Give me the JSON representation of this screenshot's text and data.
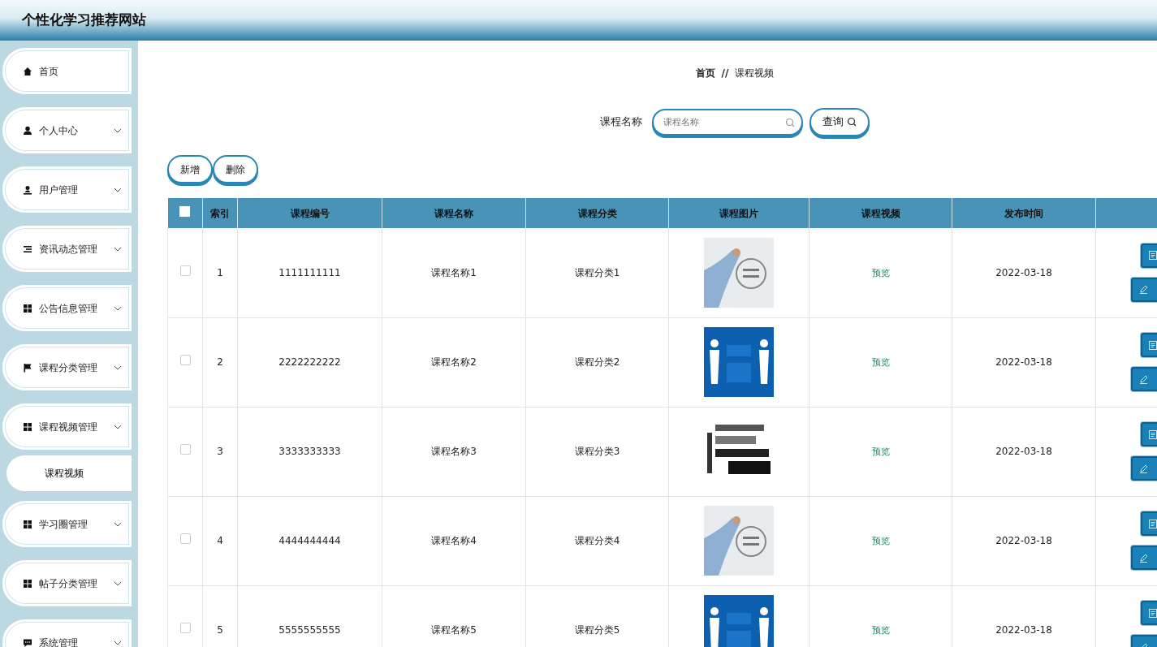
{
  "header": {
    "title": "个性化学习推荐网站"
  },
  "sidebar": {
    "items": [
      {
        "label": "首页",
        "kind": "link"
      },
      {
        "label": "个人中心",
        "kind": "menu"
      },
      {
        "label": "用户管理",
        "kind": "menu"
      },
      {
        "label": "资讯动态管理",
        "kind": "menu"
      },
      {
        "label": "公告信息管理",
        "kind": "menu"
      },
      {
        "label": "课程分类管理",
        "kind": "menu"
      },
      {
        "label": "课程视频管理",
        "kind": "menu",
        "children": [
          {
            "label": "课程视频"
          }
        ]
      },
      {
        "label": "学习圈管理",
        "kind": "menu"
      },
      {
        "label": "帖子分类管理",
        "kind": "menu"
      },
      {
        "label": "系统管理",
        "kind": "menu"
      }
    ]
  },
  "breadcrumb": [
    "首页",
    "课程视频"
  ],
  "breadcrumb_separator": "//",
  "search": {
    "label": "课程名称",
    "placeholder": "课程名称",
    "button": "查询"
  },
  "actions": [
    "新增",
    "删除"
  ],
  "table": {
    "select_all_checked": false,
    "columns": [
      "索引",
      "课程编号",
      "课程名称",
      "课程分类",
      "课程图片",
      "课程视频",
      "发布时间"
    ],
    "rows": [
      {
        "selected": false,
        "index": "1",
        "code": "1111111111",
        "name": "课程名称1",
        "category": "课程分类1",
        "video": "预览",
        "date": "2022-03-18"
      },
      {
        "selected": false,
        "index": "2",
        "code": "2222222222",
        "name": "课程名称2",
        "category": "课程分类2",
        "video": "预览",
        "date": "2022-03-18"
      },
      {
        "selected": false,
        "index": "3",
        "code": "3333333333",
        "name": "课程名称3",
        "category": "课程分类3",
        "video": "预览",
        "date": "2022-03-18"
      },
      {
        "selected": false,
        "index": "4",
        "code": "4444444444",
        "name": "课程名称4",
        "category": "课程分类4",
        "video": "预览",
        "date": "2022-03-18"
      },
      {
        "selected": false,
        "index": "5",
        "code": "5555555555",
        "name": "课程名称5",
        "category": "课程分类5",
        "video": "预览",
        "date": "2022-03-18"
      }
    ]
  }
}
